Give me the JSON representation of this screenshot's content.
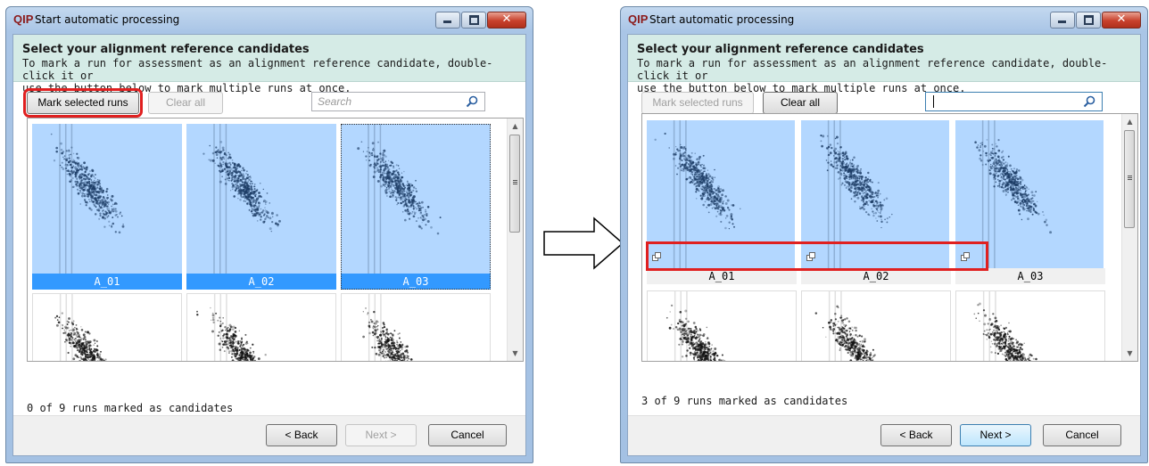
{
  "left_window": {
    "app_logo": "QIP",
    "title": "Start automatic processing",
    "header_title": "Select your alignment reference candidates",
    "header_desc_line1": "To mark a run for assessment as an alignment reference candidate, double-click it or",
    "header_desc_line2": "use the button below to mark multiple runs at once.",
    "mark_button": "Mark selected runs",
    "clear_button": "Clear all",
    "search_placeholder": "Search",
    "tiles": [
      "A_01",
      "A_02",
      "A_03"
    ],
    "status": "0 of 9 runs marked as candidates",
    "back": "< Back",
    "next": "Next >",
    "cancel": "Cancel"
  },
  "right_window": {
    "app_logo": "QIP",
    "title": "Start automatic processing",
    "header_title": "Select your alignment reference candidates",
    "header_desc_line1": "To mark a run for assessment as an alignment reference candidate, double-click it or",
    "header_desc_line2": "use the button below to mark multiple runs at once.",
    "mark_button": "Mark selected runs",
    "clear_button": "Clear all",
    "search_value": "",
    "tiles": [
      "A_01",
      "A_02",
      "A_03"
    ],
    "status": "3 of 9 runs marked as candidates",
    "back": "< Back",
    "next": "Next >",
    "cancel": "Cancel"
  },
  "colors": {
    "selection": "#3399ff",
    "tile_bg": "#b3d7ff",
    "highlight": "#e02020",
    "header_bg": "#d5ebe6"
  }
}
